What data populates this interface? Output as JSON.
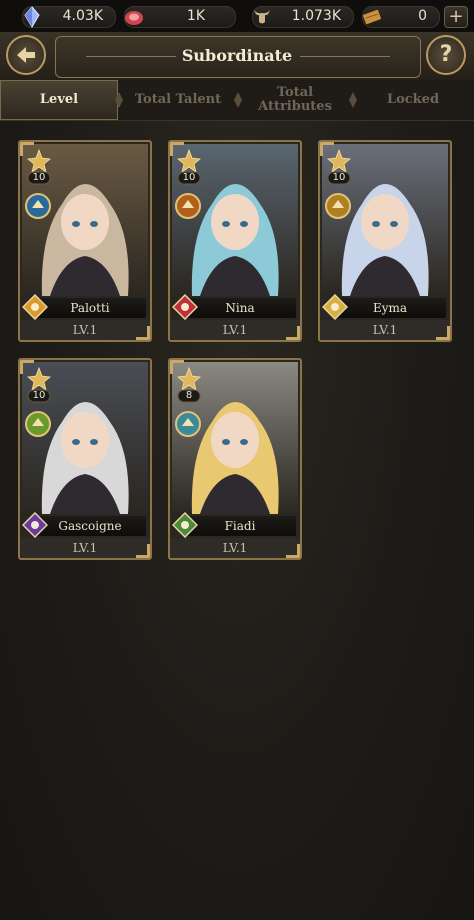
{
  "resources": [
    {
      "icon": "crystal-icon",
      "value": "4.03K"
    },
    {
      "icon": "meat-icon",
      "value": "1K"
    },
    {
      "icon": "horned-helmet-icon",
      "value": "1.073K"
    },
    {
      "icon": "wood-plank-icon",
      "value": "0"
    }
  ],
  "header": {
    "title": "Subordinate"
  },
  "tabs": [
    {
      "label": "Level",
      "active": true
    },
    {
      "label": "Total Talent",
      "active": false
    },
    {
      "label": "Total\nAttributes",
      "active": false
    },
    {
      "label": "Locked",
      "active": false
    }
  ],
  "cards": [
    {
      "name": "Palotti",
      "level": "LV.1",
      "stars": "10",
      "hair": "#c9b7a0",
      "bg": "#6a5a44",
      "element": "#d89b2a",
      "badge": "#2a6a9a"
    },
    {
      "name": "Nina",
      "level": "LV.1",
      "stars": "10",
      "hair": "#8ccad8",
      "bg": "#5a6670",
      "element": "#c0303a",
      "badge": "#b0601a"
    },
    {
      "name": "Eyma",
      "level": "LV.1",
      "stars": "10",
      "hair": "#c8d4ea",
      "bg": "#6a6f7a",
      "element": "#d8b040",
      "badge": "#b08020"
    },
    {
      "name": "Gascoigne",
      "level": "LV.1",
      "stars": "10",
      "hair": "#d8d8d8",
      "bg": "#4a4e55",
      "element": "#6a3aa0",
      "badge": "#6a9a2a"
    },
    {
      "name": "Fiadi",
      "level": "LV.1",
      "stars": "8",
      "hair": "#e8c870",
      "bg": "#8a8a82",
      "element": "#4a8a3a",
      "badge": "#3a8a9a"
    }
  ]
}
